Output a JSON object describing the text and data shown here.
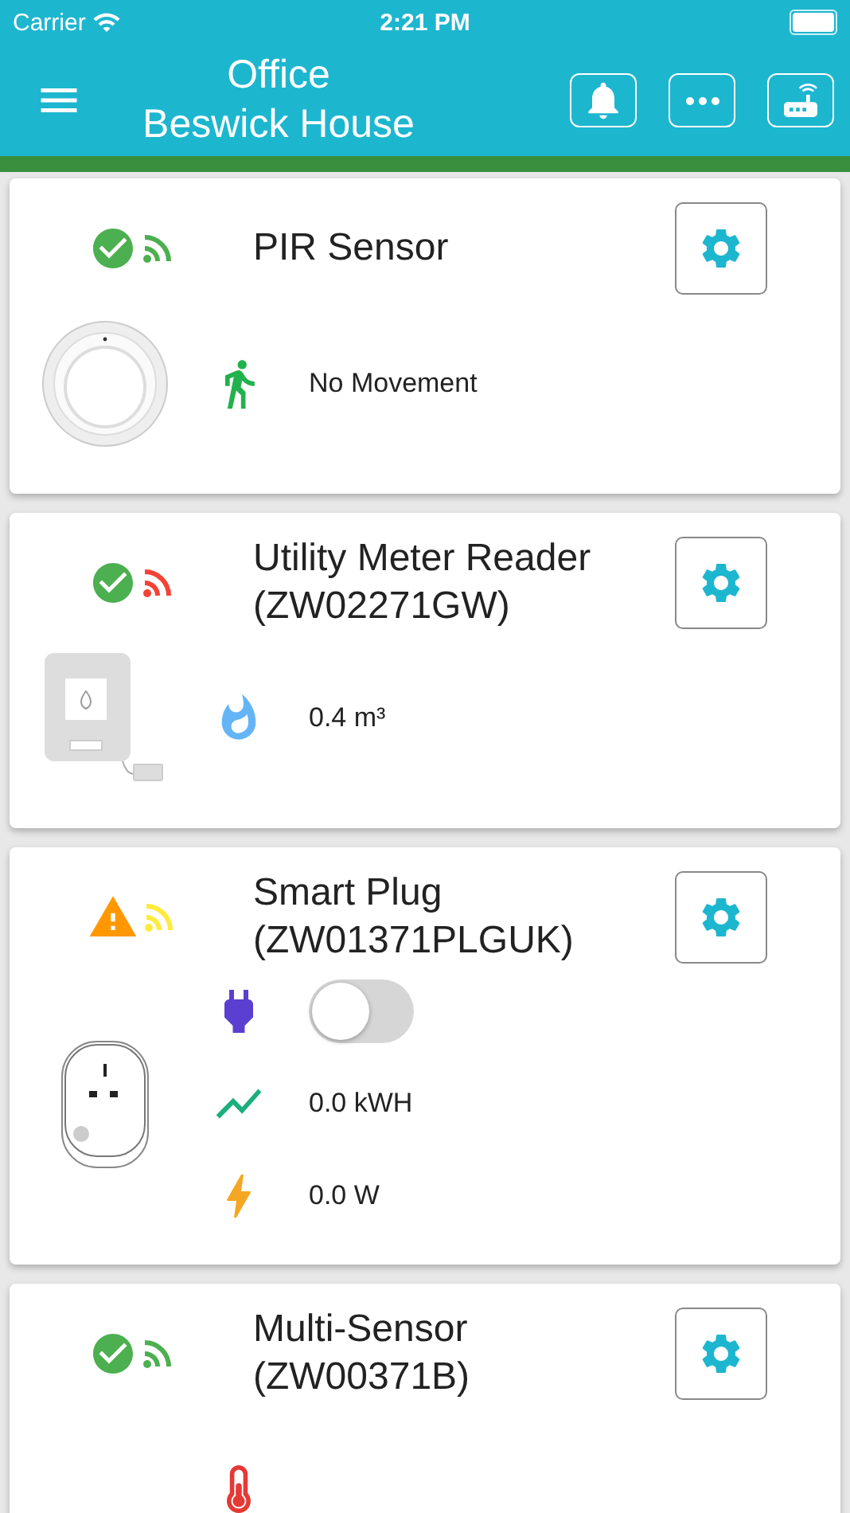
{
  "status_bar": {
    "carrier": "Carrier",
    "time": "2:21 PM"
  },
  "header": {
    "title": "Office",
    "subtitle": "Beswick House"
  },
  "devices": [
    {
      "name": "PIR Sensor",
      "warning": false,
      "color": "#4caf50",
      "kind": "pir",
      "readings": [
        {
          "kind": "motion",
          "text": "No Movement"
        }
      ]
    },
    {
      "name": "Utility Meter Reader",
      "model": "(ZW02271GW)",
      "warning": false,
      "color": "#f44336",
      "kind": "meter",
      "readings": [
        {
          "kind": "gas",
          "text": "0.4 m³"
        }
      ]
    },
    {
      "name": "Smart Plug",
      "model": "(ZW01371PLGUK)",
      "warning": true,
      "color": "#ffeb3b",
      "kind": "plug",
      "readings": [
        {
          "kind": "switch",
          "on": false
        },
        {
          "kind": "energy",
          "text": "0.0 kWH"
        },
        {
          "kind": "power",
          "text": "0.0 W"
        }
      ]
    },
    {
      "name": "Multi-Sensor",
      "model": "(ZW00371B)",
      "warning": false,
      "color": "#4caf50",
      "kind": "multi",
      "readings": [
        {
          "kind": "temperature"
        }
      ]
    }
  ]
}
